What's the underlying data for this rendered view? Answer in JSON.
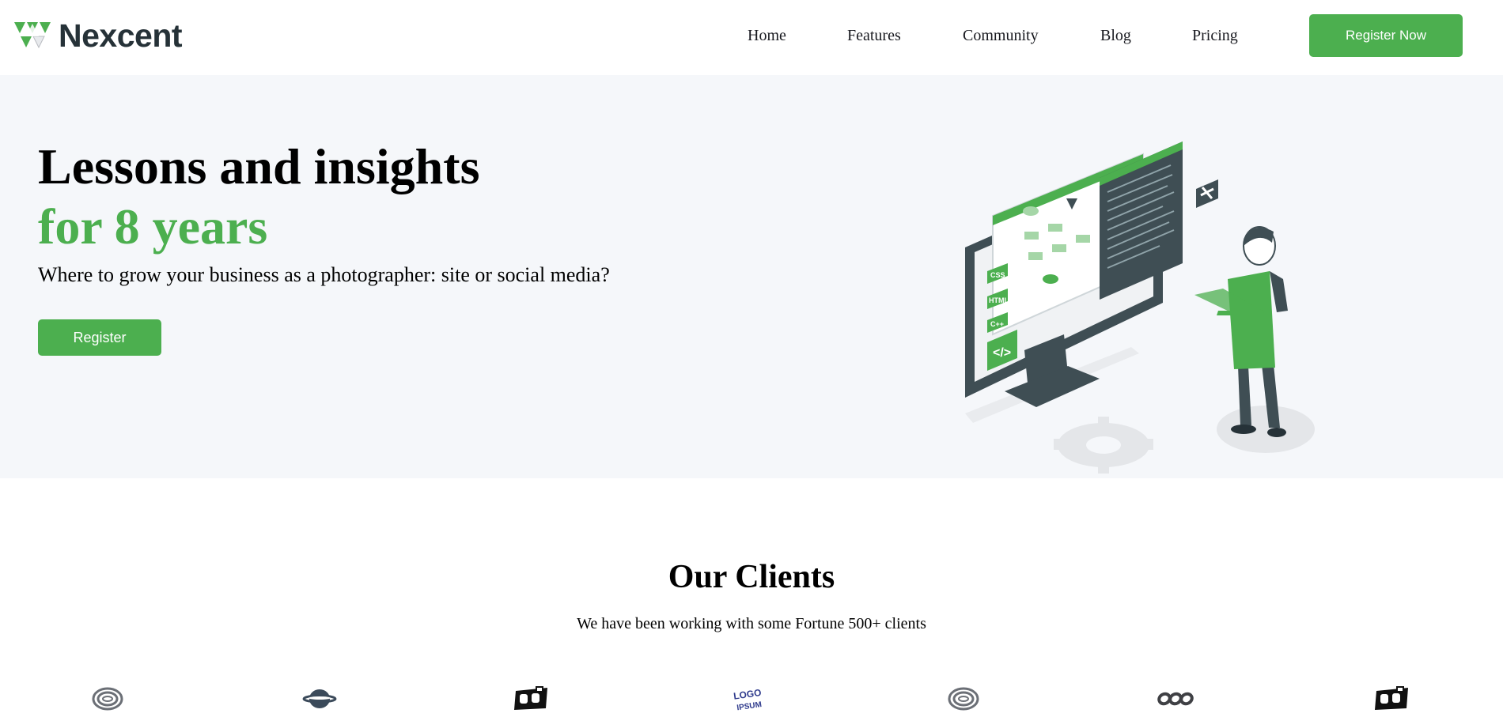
{
  "header": {
    "brand": "Nexcent",
    "logo_icon": "nexcent-logo-icon",
    "nav": [
      {
        "label": "Home"
      },
      {
        "label": "Features"
      },
      {
        "label": "Community"
      },
      {
        "label": "Blog"
      },
      {
        "label": "Pricing"
      }
    ],
    "cta_label": "Register Now"
  },
  "hero": {
    "title_line1": "Lessons and insights",
    "title_line2": "for 8 years",
    "subtitle": "Where to grow your business as a photographer: site or social media?",
    "cta_label": "Register",
    "illustration_labels": [
      "CSS",
      "HTML",
      "C++"
    ]
  },
  "clients": {
    "title": "Our Clients",
    "subtitle": "We have been working with some Fortune 500+ clients",
    "logos": [
      {
        "icon": "concentric-ring-logo-icon"
      },
      {
        "icon": "saturn-ring-logo-icon"
      },
      {
        "icon": "oj-block-logo-icon"
      },
      {
        "icon": "logoipsum-logo-icon",
        "text": "LOGO IPSUM"
      },
      {
        "icon": "concentric-ring-logo-icon"
      },
      {
        "icon": "chain-link-logo-icon"
      },
      {
        "icon": "oj-block-logo-icon"
      }
    ]
  },
  "colors": {
    "brand_green": "#4caf4f",
    "hero_bg": "#f5f7fa",
    "dark_text": "#263238",
    "nav_text": "#18191f"
  }
}
